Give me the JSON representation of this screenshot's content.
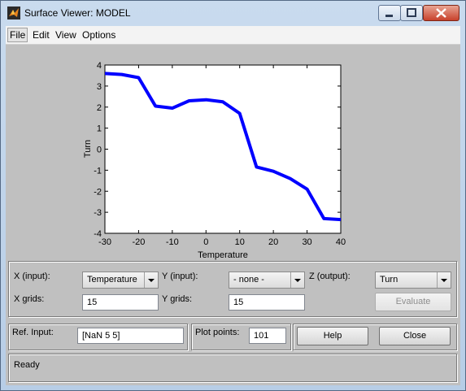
{
  "window": {
    "title": "Surface Viewer: MODEL"
  },
  "menu": {
    "items": [
      "File",
      "Edit",
      "View",
      "Options"
    ]
  },
  "chart_data": {
    "type": "line",
    "xlabel": "Temperature",
    "ylabel": "Turn",
    "xlim": [
      -30,
      40
    ],
    "ylim": [
      -4,
      4
    ],
    "xticks": [
      -30,
      -20,
      -10,
      0,
      10,
      20,
      30,
      40
    ],
    "yticks": [
      4,
      3,
      2,
      1,
      0,
      -1,
      -2,
      -3,
      -4
    ],
    "color": "#0000ff",
    "series": [
      {
        "x": [
          -30,
          -25,
          -20,
          -15,
          -10,
          -5,
          0,
          5,
          10,
          15,
          20,
          25,
          30,
          35,
          40
        ],
        "values": [
          3.6,
          3.55,
          3.4,
          2.05,
          1.95,
          2.3,
          2.35,
          2.25,
          1.7,
          -0.85,
          -1.05,
          -1.4,
          -1.9,
          -3.3,
          -3.35
        ]
      }
    ]
  },
  "controls": {
    "x_input_label": "X (input):",
    "x_input_value": "Temperature",
    "y_input_label": "Y (input):",
    "y_input_value": "- none -",
    "z_output_label": "Z (output):",
    "z_output_value": "Turn",
    "x_grids_label": "X grids:",
    "x_grids_value": "15",
    "y_grids_label": "Y grids:",
    "y_grids_value": "15",
    "evaluate_label": "Evaluate",
    "ref_input_label": "Ref. Input:",
    "ref_input_value": "[NaN 5 5]",
    "plot_points_label": "Plot points:",
    "plot_points_value": "101",
    "help_label": "Help",
    "close_label": "Close"
  },
  "status": {
    "text": "Ready"
  }
}
